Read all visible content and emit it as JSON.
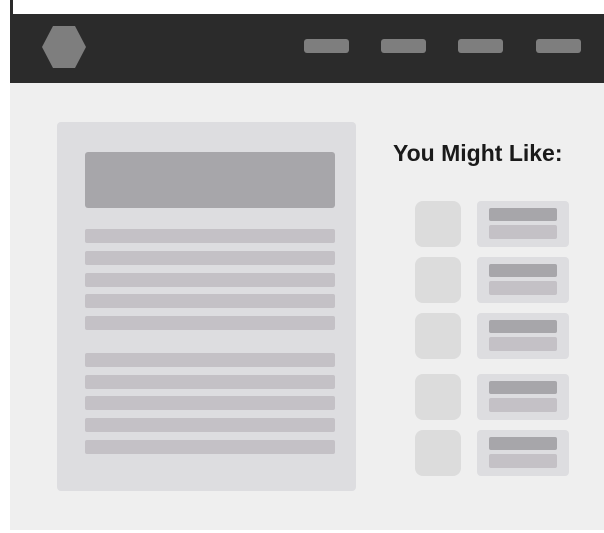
{
  "colors": {
    "topbar": "#2b2b2b",
    "logo": "#7e7e7e",
    "nav_link": "#7e7e7e",
    "page_background": "#efefef",
    "panel": "#dddde0",
    "placeholder_dark": "#a7a6aa",
    "placeholder_light": "#c4c1c6",
    "thumbnail": "#dcdcdc"
  },
  "header": {
    "logo_icon": "hexagon-icon",
    "nav_links_count_label": ""
  },
  "sidebar": {
    "title": "You Might Like:"
  }
}
